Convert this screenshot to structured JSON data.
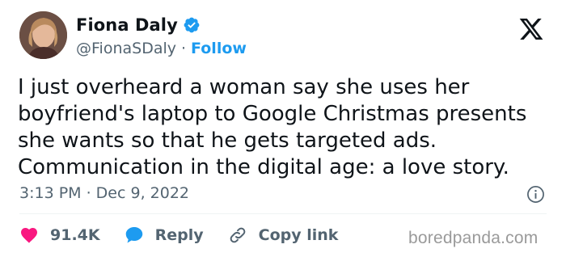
{
  "author": {
    "display_name": "Fiona Daly",
    "handle": "@FionaSDaly",
    "separator": "·",
    "follow_label": "Follow",
    "verified_color": "#1d9bf0"
  },
  "tweet": {
    "text": "I just overheard a woman say she uses her\nboyfriend's laptop to Google Christmas presents\nshe wants so that he gets targeted ads.\nCommunication in the digital age: a love story.",
    "timestamp": "3:13 PM · Dec 9, 2022"
  },
  "actions": {
    "like_count": "91.4K",
    "reply_label": "Reply",
    "copy_link_label": "Copy link"
  },
  "icons": {
    "platform": "x-logo-icon",
    "info": "info-icon",
    "like": "heart-icon",
    "reply": "reply-bubble-icon",
    "copy_link": "link-icon"
  },
  "colors": {
    "like": "#f91880",
    "reply": "#1d9bf0",
    "link": "#1d9bf0",
    "secondary_text": "#536471",
    "primary_text": "#0f1419"
  },
  "watermark": "boredpanda.com"
}
